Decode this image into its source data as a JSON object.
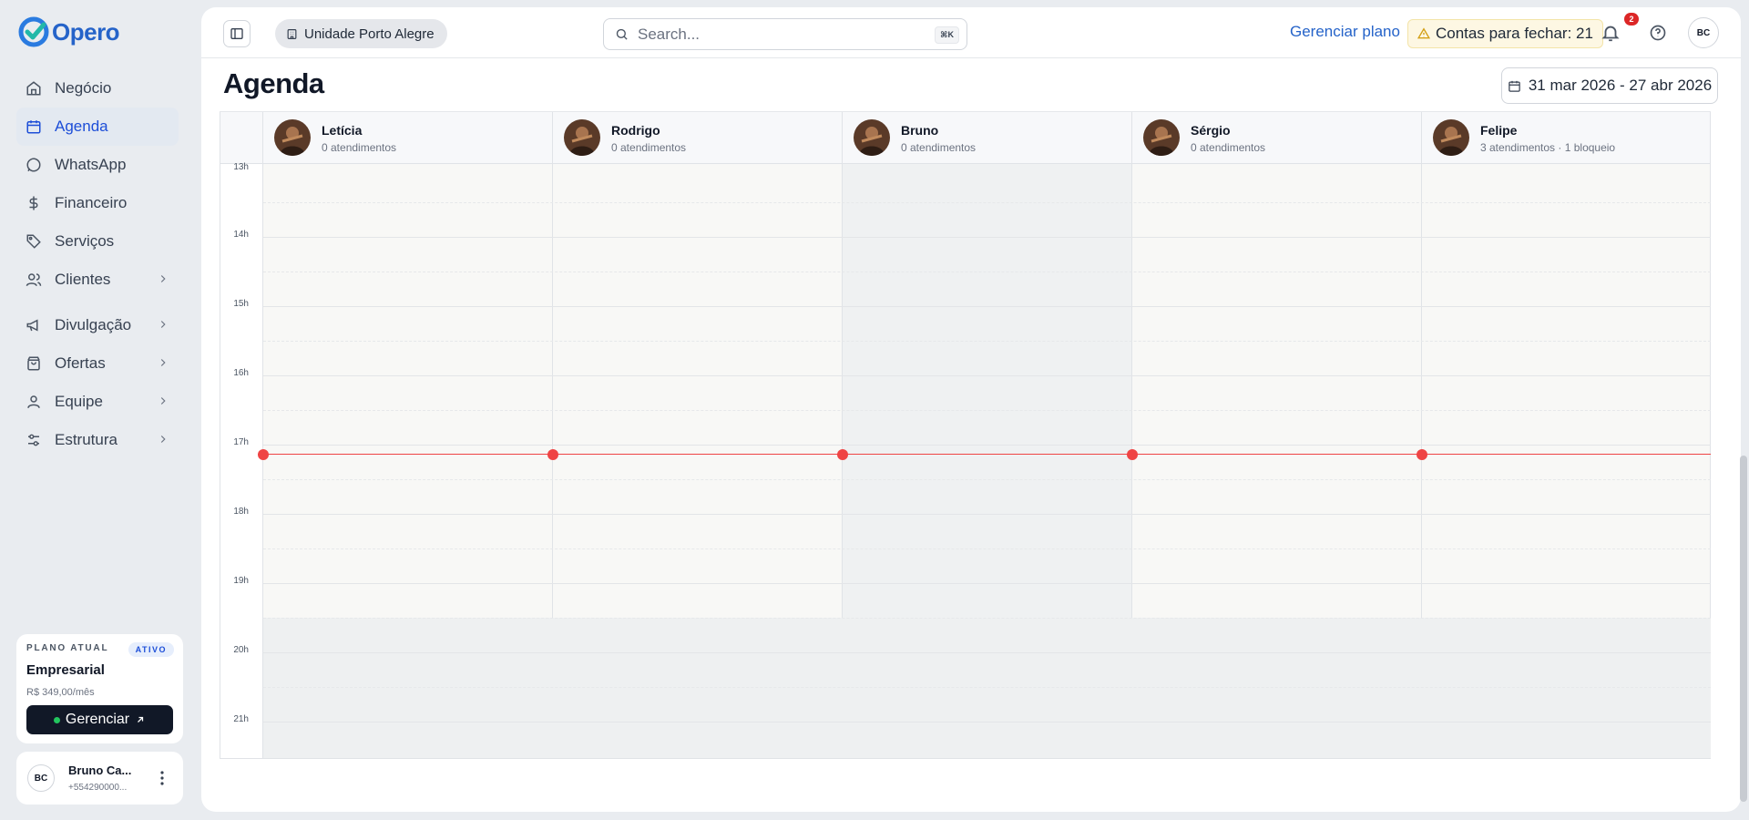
{
  "app": {
    "name": "Opero"
  },
  "sidebar": {
    "items": [
      {
        "label": "Negócio",
        "icon": "home-icon"
      },
      {
        "label": "Agenda",
        "icon": "calendar-icon",
        "active": true
      },
      {
        "label": "WhatsApp",
        "icon": "chat-icon"
      },
      {
        "label": "Financeiro",
        "icon": "dollar-icon"
      },
      {
        "label": "Serviços",
        "icon": "tag-icon"
      },
      {
        "label": "Clientes",
        "icon": "users-icon",
        "expandable": true
      },
      {
        "label": "Divulgação",
        "icon": "megaphone-icon",
        "expandable": true
      },
      {
        "label": "Ofertas",
        "icon": "bag-icon",
        "expandable": true
      },
      {
        "label": "Equipe",
        "icon": "user-icon",
        "expandable": true
      },
      {
        "label": "Estrutura",
        "icon": "sliders-icon",
        "expandable": true
      }
    ],
    "plan": {
      "label": "PLANO ATUAL",
      "badge": "ATIVO",
      "name": "Empresarial",
      "price": "R$ 349,00/mês",
      "button": "Gerenciar"
    },
    "user": {
      "initials": "BC",
      "name": "Bruno Ca...",
      "phone": "+554290000..."
    }
  },
  "topbar": {
    "unit": "Unidade Porto Alegre",
    "search_placeholder": "Search...",
    "search_shortcut": "⌘K",
    "manage_plan": "Gerenciar plano",
    "accounts_to_close": "Contas para fechar: 21",
    "notifications_count": "2",
    "user_initials": "BC"
  },
  "page": {
    "title": "Agenda",
    "date_range": "31 mar 2026 - 27 abr 2026"
  },
  "calendar": {
    "staff": [
      {
        "name": "Letícia",
        "sub": "0 atendimentos"
      },
      {
        "name": "Rodrigo",
        "sub": "0 atendimentos"
      },
      {
        "name": "Bruno",
        "sub": "0 atendimentos"
      },
      {
        "name": "Sérgio",
        "sub": "0 atendimentos"
      },
      {
        "name": "Felipe",
        "sub": "3 atendimentos · 1 bloqueio"
      }
    ],
    "hours": [
      "13h",
      "14h",
      "15h",
      "16h",
      "17h",
      "18h",
      "19h",
      "20h",
      "21h"
    ],
    "colors": {
      "now_line": "#ef4444",
      "accent": "#2563c9"
    }
  }
}
